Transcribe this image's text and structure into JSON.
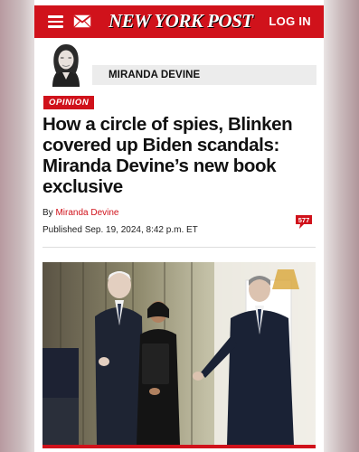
{
  "header": {
    "logo_text": "NEW YORK POST",
    "login_label": "LOG IN",
    "menu_icon": "hamburger-menu-icon",
    "mail_icon": "mail-icon",
    "brand_color": "#d0121b"
  },
  "author_card": {
    "name": "MIRANDA DEVINE"
  },
  "article": {
    "section_tag": "OPINION",
    "headline": "How a circle of spies, Blinken covered up Biden scandals: Miranda Devine’s new book exclusive",
    "byline_prefix": "By ",
    "byline_author": "Miranda Devine",
    "published": "Published Sep. 19, 2024, 8:42 p.m. ET",
    "comment_count": "577",
    "comment_icon": "comment-bubble-icon"
  }
}
